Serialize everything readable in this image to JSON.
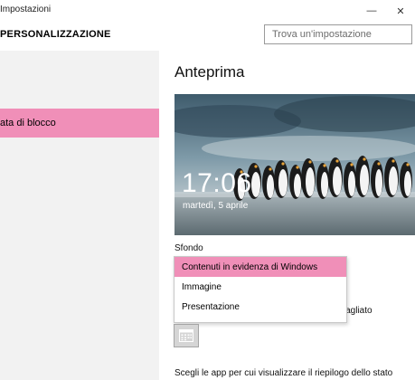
{
  "window": {
    "title": "Impostazioni",
    "controls": {
      "minimize": "—",
      "close": "✕"
    }
  },
  "header": {
    "section_title": "PERSONALIZZAZIONE",
    "search_placeholder": "Trova un'impostazione"
  },
  "sidebar": {
    "items": [
      {
        "label": "ata di blocco",
        "selected": true
      }
    ]
  },
  "main": {
    "heading": "Anteprima",
    "preview": {
      "time": "17:06",
      "date": "martedì, 5 aprile"
    },
    "background_label": "Sfondo",
    "dropdown": {
      "options": [
        {
          "label": "Contenuti in evidenza di Windows",
          "selected": true
        },
        {
          "label": "Immagine",
          "selected": false
        },
        {
          "label": "Presentazione",
          "selected": false
        }
      ]
    },
    "partial_text": "ettagliato",
    "calendar_icon": "calendar-icon",
    "bottom_text": "Scegli le app per cui visualizzare il riepilogo dello stato"
  },
  "colors": {
    "accent": "#f08fb8",
    "sidebar_bg": "#f2f2f2"
  }
}
